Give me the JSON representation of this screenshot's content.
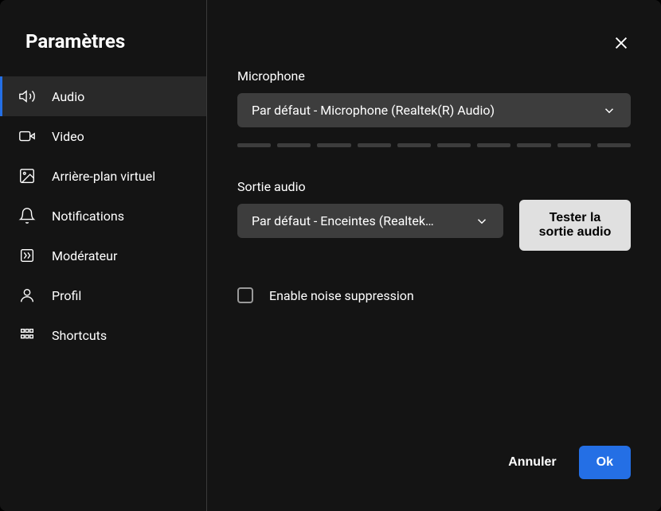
{
  "title": "Paramètres",
  "sidebar": {
    "items": [
      {
        "label": "Audio"
      },
      {
        "label": "Video"
      },
      {
        "label": "Arrière-plan virtuel"
      },
      {
        "label": "Notifications"
      },
      {
        "label": "Modérateur"
      },
      {
        "label": "Profil"
      },
      {
        "label": "Shortcuts"
      }
    ]
  },
  "main": {
    "microphone_label": "Microphone",
    "microphone_value": "Par défaut - Microphone (Realtek(R) Audio)",
    "output_label": "Sortie audio",
    "output_value": "Par défaut - Enceintes (Realtek…",
    "test_button": "Tester la sortie audio",
    "noise_suppression_label": "Enable noise suppression"
  },
  "footer": {
    "cancel": "Annuler",
    "ok": "Ok"
  }
}
